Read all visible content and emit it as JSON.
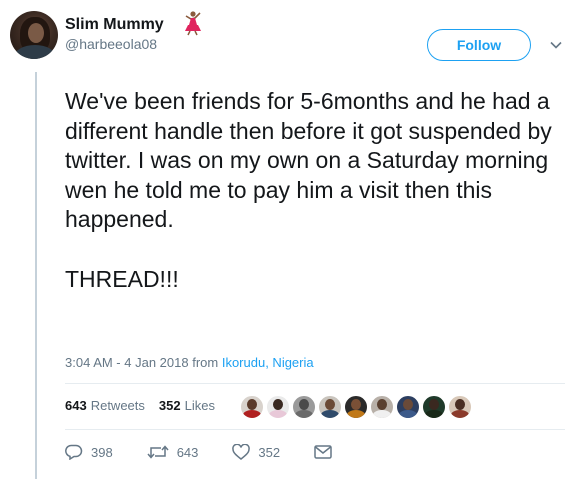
{
  "author": {
    "display_name": "Slim Mummy",
    "handle": "@harbeeola08"
  },
  "follow_button": {
    "label": "Follow"
  },
  "tweet": {
    "text": "We've been friends for 5-6months and he had a different handle then before it got suspended by twitter. I was on my own on a Saturday morning wen he told me to pay him a visit then this happened.\n\nTHREAD!!!",
    "time": "3:04 AM - 4 Jan 2018",
    "from_label": "from",
    "location": "Ikorudu, Nigeria"
  },
  "stats": {
    "retweets_count": "643",
    "retweets_label": "Retweets",
    "likes_count": "352",
    "likes_label": "Likes"
  },
  "actions": {
    "replies": "398",
    "retweets": "643",
    "likes": "352"
  },
  "colors": {
    "accent": "#1da1f2",
    "secondary_text": "#657786",
    "thread_line": "#c5d1da"
  },
  "icons": [
    "dancer-emoji-icon",
    "chevron-down-icon",
    "reply-icon",
    "retweet-icon",
    "like-icon",
    "direct-message-icon"
  ]
}
